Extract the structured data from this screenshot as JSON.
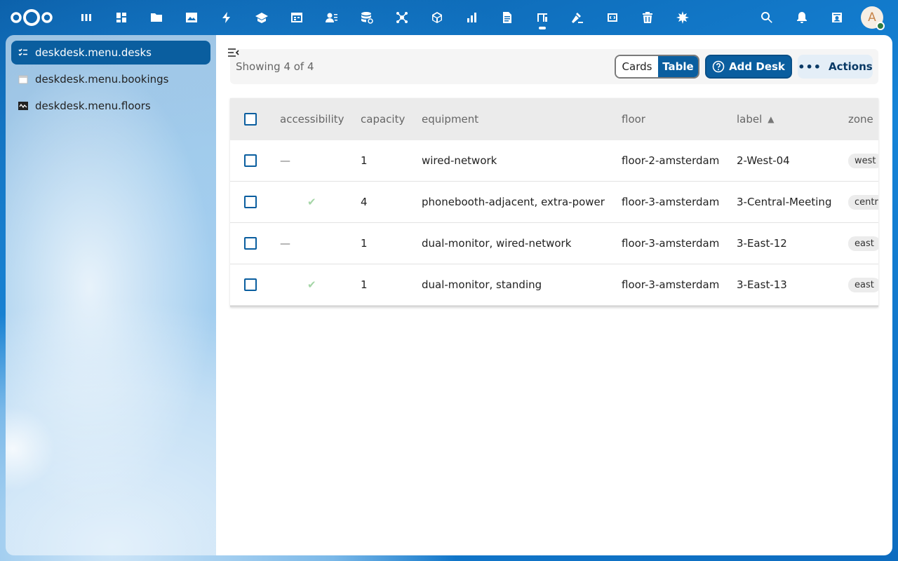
{
  "header": {
    "apps": [
      {
        "name": "apps-icon"
      },
      {
        "name": "dashboard-icon"
      },
      {
        "name": "files-icon"
      },
      {
        "name": "photos-icon"
      },
      {
        "name": "activity-icon"
      },
      {
        "name": "learn-icon"
      },
      {
        "name": "calendar-table-icon"
      },
      {
        "name": "contacts-icon"
      },
      {
        "name": "database-icon"
      },
      {
        "name": "network-icon"
      },
      {
        "name": "cube-icon"
      },
      {
        "name": "chart-hand-icon"
      },
      {
        "name": "document-icon"
      },
      {
        "name": "deskdesk-icon",
        "active": true
      },
      {
        "name": "gavel-icon"
      },
      {
        "name": "code-icon"
      },
      {
        "name": "trash-icon"
      },
      {
        "name": "settings-burst-icon"
      }
    ],
    "avatar_initial": "A"
  },
  "sidebar": {
    "items": [
      {
        "label": "deskdesk.menu.desks",
        "icon": "checklist-icon",
        "active": true
      },
      {
        "label": "deskdesk.menu.bookings",
        "icon": "calendar-icon",
        "active": false
      },
      {
        "label": "deskdesk.menu.floors",
        "icon": "floorplan-icon",
        "active": false
      }
    ]
  },
  "toolbar": {
    "showing": "Showing 4 of 4",
    "view_cards": "Cards",
    "view_table": "Table",
    "add_desk": "Add Desk",
    "actions": "Actions"
  },
  "table": {
    "headers": {
      "accessibility": "accessibility",
      "capacity": "capacity",
      "equipment": "equipment",
      "floor": "floor",
      "label": "label",
      "zone": "zone"
    },
    "sort_indicator": "▲",
    "rows": [
      {
        "accessibility": "—",
        "capacity": "1",
        "equipment": "wired-network",
        "floor": "floor-2-amsterdam",
        "label": "2-West-04",
        "zone": "west"
      },
      {
        "accessibility": "✔",
        "capacity": "4",
        "equipment": "phonebooth-adjacent, extra-power",
        "floor": "floor-3-amsterdam",
        "label": "3-Central-Meeting",
        "zone": "central"
      },
      {
        "accessibility": "—",
        "capacity": "1",
        "equipment": "dual-monitor, wired-network",
        "floor": "floor-3-amsterdam",
        "label": "3-East-12",
        "zone": "east"
      },
      {
        "accessibility": "✔",
        "capacity": "1",
        "equipment": "dual-monitor, standing",
        "floor": "floor-3-amsterdam",
        "label": "3-East-13",
        "zone": "east"
      }
    ]
  }
}
